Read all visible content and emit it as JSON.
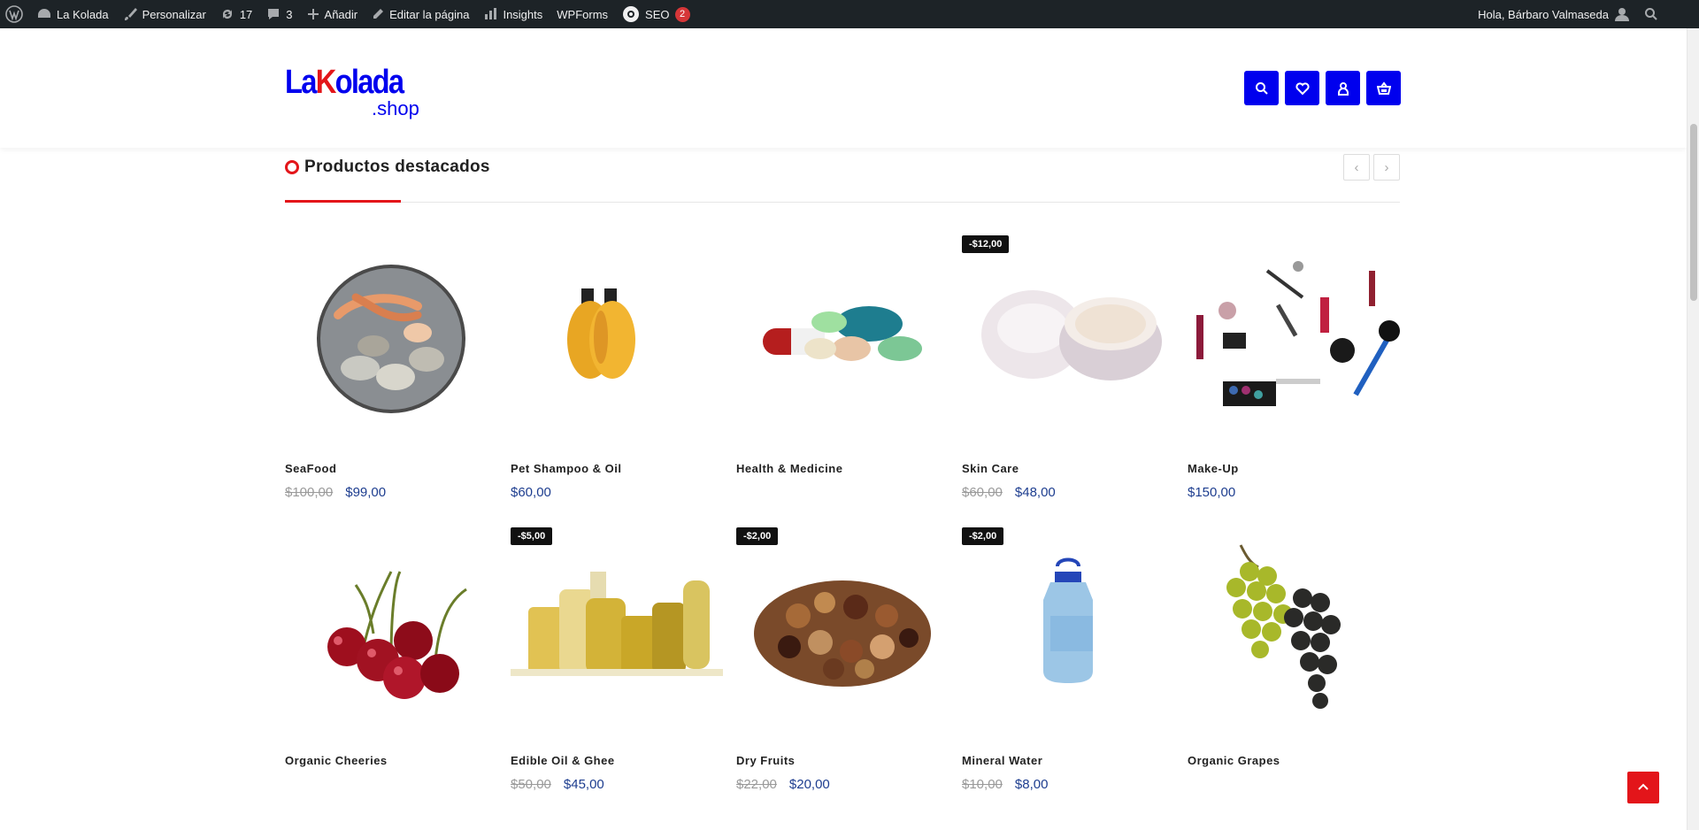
{
  "admin_bar": {
    "site_name": "La Kolada",
    "customize": "Personalizar",
    "updates_count": "17",
    "comments_count": "3",
    "new_label": "Añadir",
    "edit_page": "Editar la página",
    "insights": "Insights",
    "wpforms": "WPForms",
    "seo": "SEO",
    "seo_badge": "2",
    "greeting": "Hola, Bárbaro Valmaseda"
  },
  "header": {
    "logo_main_1": "La",
    "logo_main_2": "olada",
    "logo_k": "K",
    "logo_sub": ".shop",
    "brand_blue": "#0000ee",
    "brand_red": "#e3151a"
  },
  "section": {
    "title": "Productos destacados",
    "prev_arrow": "‹",
    "next_arrow": "›"
  },
  "products": [
    {
      "name": "SeaFood",
      "old_price": "$100,00",
      "price": "$99,00",
      "badge": ""
    },
    {
      "name": "Pet Shampoo & Oil",
      "old_price": "",
      "price": "$60,00",
      "badge": ""
    },
    {
      "name": "Health & Medicine",
      "old_price": "",
      "price": "",
      "badge": ""
    },
    {
      "name": "Skin Care",
      "old_price": "$60,00",
      "price": "$48,00",
      "badge": "-$12,00"
    },
    {
      "name": "Make-Up",
      "old_price": "",
      "price": "$150,00",
      "badge": ""
    },
    {
      "name": "Organic Cheeries",
      "old_price": "",
      "price": "",
      "badge": ""
    },
    {
      "name": "Edible Oil & Ghee",
      "old_price": "$50,00",
      "price": "$45,00",
      "badge": "-$5,00"
    },
    {
      "name": "Dry Fruits",
      "old_price": "$22,00",
      "price": "$20,00",
      "badge": "-$2,00"
    },
    {
      "name": "Mineral Water",
      "old_price": "$10,00",
      "price": "$8,00",
      "badge": "-$2,00"
    },
    {
      "name": "Organic Grapes",
      "old_price": "",
      "price": "",
      "badge": ""
    }
  ]
}
